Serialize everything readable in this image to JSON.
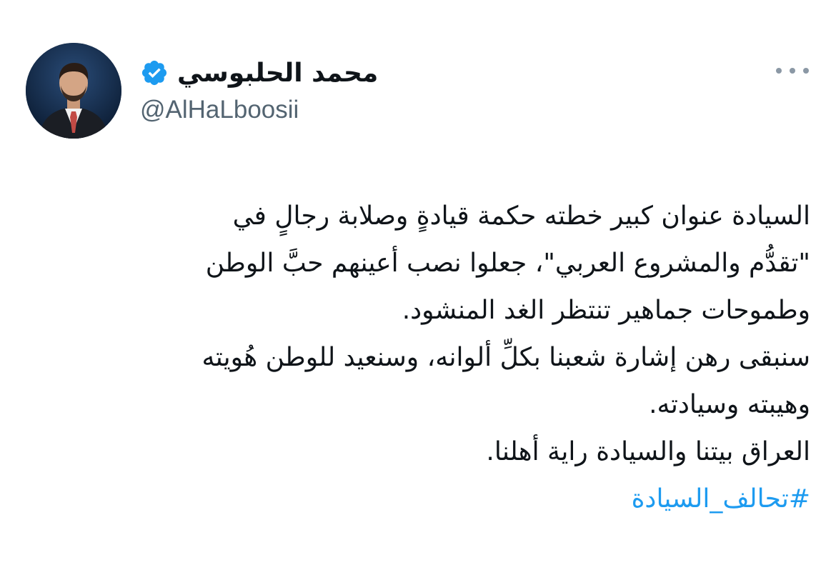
{
  "author": {
    "display_name": "محمد الحلبوسي",
    "handle": "@AlHaLboosii",
    "verified": true,
    "verified_color": "#1d9bf0",
    "avatar_icon": "profile-photo"
  },
  "menu": {
    "icon": "more-horizontal-icon"
  },
  "tweet": {
    "lines": [
      "السيادة عنوان كبير خطته حكمة قيادةٍ وصلابة رجالٍ في",
      "\"تقدُّم والمشروع العربي\"، جعلوا نصب أعينهم حبَّ الوطن",
      "وطموحات جماهير تنتظر الغد المنشود.",
      "سنبقى رهن إشارة شعبنا بكلِّ ألوانه، وسنعيد للوطن هُويته",
      "وهيبته وسيادته.",
      "العراق بيتنا والسيادة راية أهلنا."
    ],
    "hashtag": "#تحالف_السيادة",
    "hashtag_color": "#1d9bf0"
  }
}
